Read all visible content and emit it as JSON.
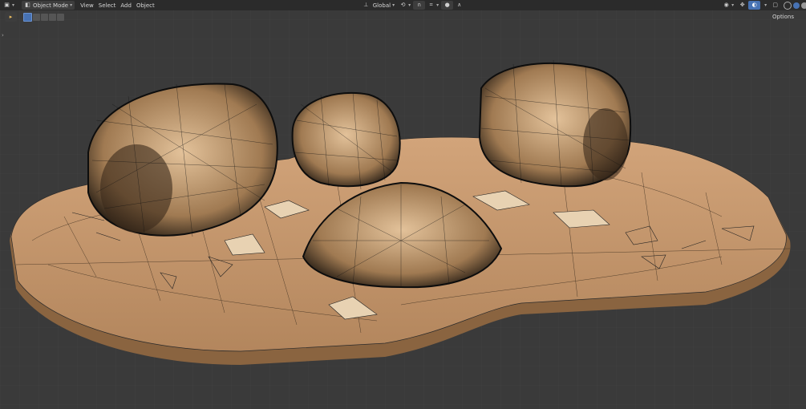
{
  "header": {
    "mode_label": "Object Mode",
    "menus": [
      "View",
      "Select",
      "Add",
      "Object"
    ],
    "orientation_label": "Global",
    "options_label": "Options"
  },
  "icons": {
    "editor_type": "cube-icon",
    "mode": "object-mode-icon",
    "transform_pivot": "pivot-icon",
    "snap": "magnet-icon",
    "proportional": "proportional-edit-icon",
    "tool": "select-box-icon",
    "viewport_shading": [
      "wireframe-shading-icon",
      "solid-shading-icon",
      "material-shading-icon",
      "rendered-shading-icon"
    ]
  },
  "colors": {
    "header_bg": "#2b2b2b",
    "viewport_bg": "#3a3a3a",
    "accent": "#4772b3",
    "ground": "#c89a6e",
    "hay": "#d9b48a",
    "wire": "#111111"
  }
}
